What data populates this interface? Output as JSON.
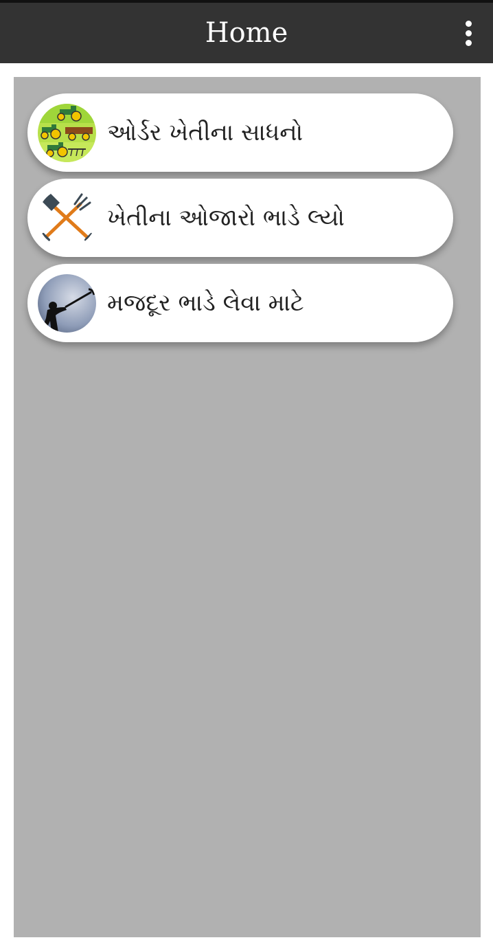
{
  "appbar": {
    "title": "Home",
    "overflow_icon": "more-vert-icon"
  },
  "colors": {
    "appbar_bg": "#333333",
    "panel_bg": "#b1b1b1",
    "card_bg": "#ffffff"
  },
  "menu": {
    "items": [
      {
        "label": "ઓર્ડર ખેતીના સાધનો",
        "icon": "tractors-icon"
      },
      {
        "label": "ખેતીના ઓજારો ભાડે લ્યો",
        "icon": "shovel-pitchfork-icon"
      },
      {
        "label": "મજદૂર ભાડે લેવા માટે",
        "icon": "laborer-icon"
      }
    ]
  }
}
